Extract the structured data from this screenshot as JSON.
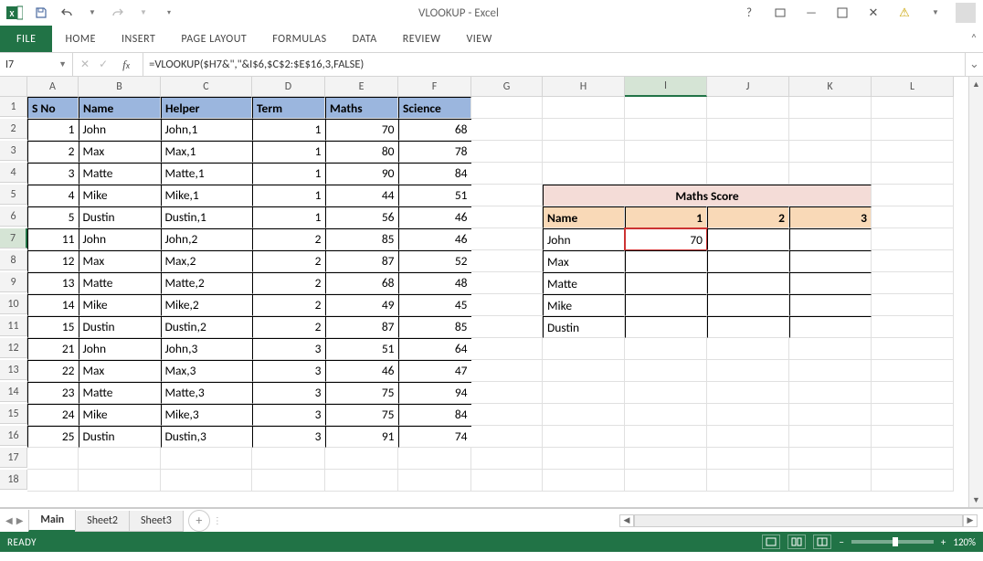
{
  "title": "VLOOKUP - Excel",
  "ribbon": {
    "file": "FILE",
    "tabs": [
      "HOME",
      "INSERT",
      "PAGE LAYOUT",
      "FORMULAS",
      "DATA",
      "REVIEW",
      "VIEW"
    ]
  },
  "namebox": "I7",
  "formula": "=VLOOKUP($H7&\",\"&I$6,$C$2:$E$16,3,FALSE)",
  "columns": [
    "A",
    "B",
    "C",
    "D",
    "E",
    "F",
    "G",
    "H",
    "I",
    "J",
    "K",
    "L"
  ],
  "rows": [
    "1",
    "2",
    "3",
    "4",
    "5",
    "6",
    "7",
    "8",
    "9",
    "10",
    "11",
    "12",
    "13",
    "14",
    "15",
    "16",
    "17",
    "18"
  ],
  "active_col": "I",
  "active_row": "7",
  "table": {
    "headers": [
      "S No",
      "Name",
      "Helper",
      "Term",
      "Maths",
      "Science"
    ],
    "rows": [
      [
        "1",
        "John",
        "John,1",
        "1",
        "70",
        "68"
      ],
      [
        "2",
        "Max",
        "Max,1",
        "1",
        "80",
        "78"
      ],
      [
        "3",
        "Matte",
        "Matte,1",
        "1",
        "90",
        "84"
      ],
      [
        "4",
        "Mike",
        "Mike,1",
        "1",
        "44",
        "51"
      ],
      [
        "5",
        "Dustin",
        "Dustin,1",
        "1",
        "56",
        "46"
      ],
      [
        "11",
        "John",
        "John,2",
        "2",
        "85",
        "46"
      ],
      [
        "12",
        "Max",
        "Max,2",
        "2",
        "87",
        "52"
      ],
      [
        "13",
        "Matte",
        "Matte,2",
        "2",
        "68",
        "48"
      ],
      [
        "14",
        "Mike",
        "Mike,2",
        "2",
        "49",
        "45"
      ],
      [
        "15",
        "Dustin",
        "Dustin,2",
        "2",
        "87",
        "85"
      ],
      [
        "21",
        "John",
        "John,3",
        "3",
        "51",
        "64"
      ],
      [
        "22",
        "Max",
        "Max,3",
        "3",
        "46",
        "47"
      ],
      [
        "23",
        "Matte",
        "Matte,3",
        "3",
        "75",
        "94"
      ],
      [
        "24",
        "Mike",
        "Mike,3",
        "3",
        "75",
        "84"
      ],
      [
        "25",
        "Dustin",
        "Dustin,3",
        "3",
        "91",
        "74"
      ]
    ]
  },
  "score": {
    "title": "Maths Score",
    "name_label": "Name",
    "col_headers": [
      "1",
      "2",
      "3"
    ],
    "rows": [
      {
        "name": "John",
        "vals": [
          "70",
          "",
          ""
        ]
      },
      {
        "name": "Max",
        "vals": [
          "",
          "",
          ""
        ]
      },
      {
        "name": "Matte",
        "vals": [
          "",
          "",
          ""
        ]
      },
      {
        "name": "Mike",
        "vals": [
          "",
          "",
          ""
        ]
      },
      {
        "name": "Dustin",
        "vals": [
          "",
          "",
          ""
        ]
      }
    ]
  },
  "sheets": {
    "active": "Main",
    "tabs": [
      "Main",
      "Sheet2",
      "Sheet3"
    ]
  },
  "status": {
    "ready": "READY",
    "zoom": "120%"
  }
}
